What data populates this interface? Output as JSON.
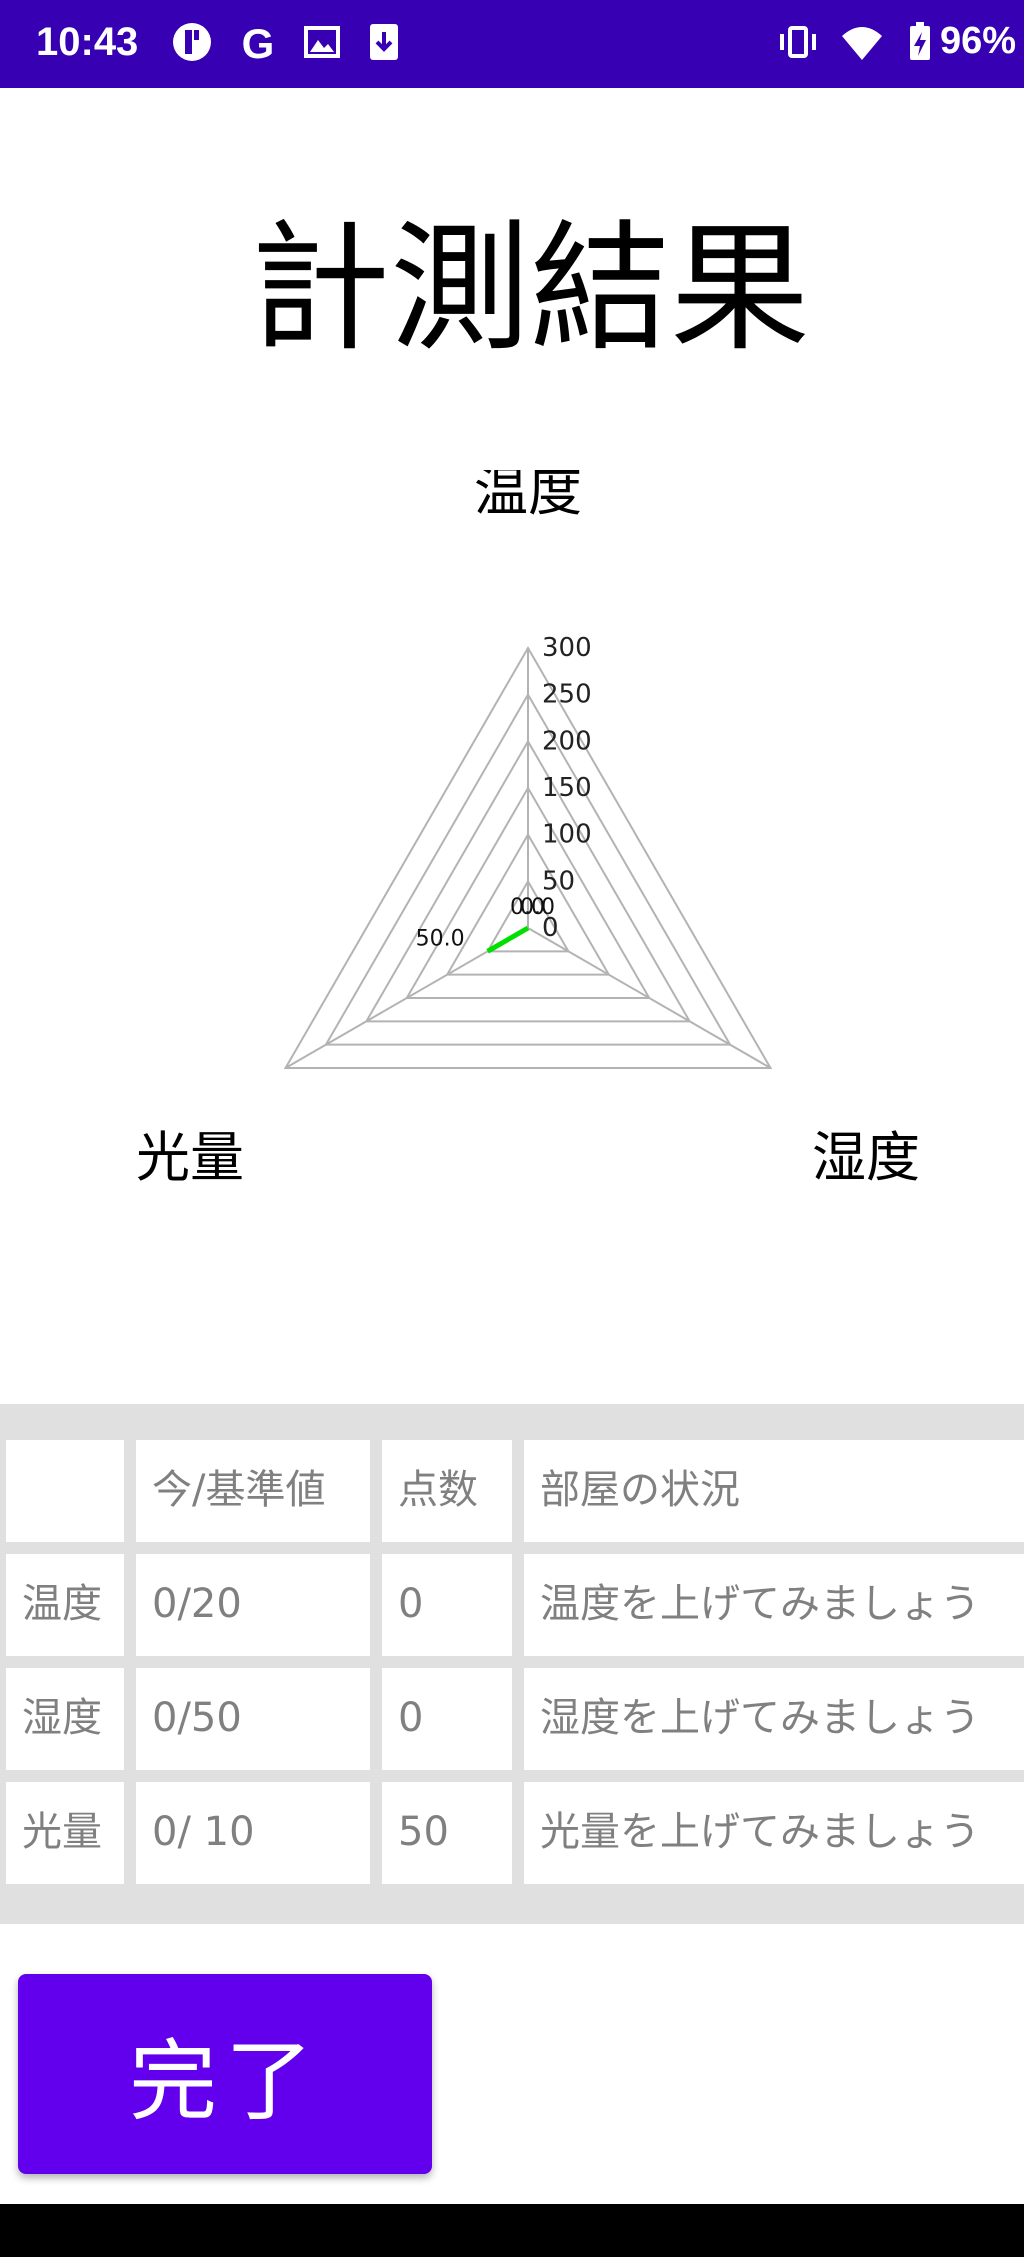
{
  "status_bar": {
    "time": "10:43",
    "battery_percent": "96%",
    "left_icons": [
      "app-icon",
      "google-icon",
      "image-icon",
      "download-icon"
    ],
    "right_icons": [
      "vibrate-icon",
      "wifi-icon",
      "battery-charging-icon"
    ]
  },
  "title": "計測結果",
  "chart_data": {
    "type": "radar",
    "axes": [
      "温度",
      "湿度",
      "光量"
    ],
    "rlim": [
      0,
      300
    ],
    "ticks": [
      "0",
      "50",
      "100",
      "150",
      "200",
      "250",
      "300"
    ],
    "series": [
      {
        "values": [
          0,
          0,
          50
        ],
        "point_labels": [
          "0.0",
          "0.0",
          "50.0"
        ],
        "color": "#00e000"
      }
    ],
    "grid_color": "#b3b3b3",
    "legend": "none"
  },
  "table": {
    "headers": [
      "",
      "今/基準値",
      "点数",
      "部屋の状況"
    ],
    "rows": [
      [
        "温度",
        "0/20",
        "0",
        "温度を上げてみましょう"
      ],
      [
        "湿度",
        "0/50",
        "0",
        "湿度を上げてみましょう"
      ],
      [
        "光量",
        "0/ 10",
        "50",
        "光量を上げてみましょう"
      ]
    ]
  },
  "done_button": {
    "label": "完了"
  },
  "colors": {
    "status_bar": "#3700b3",
    "primary": "#6200ee",
    "table_bg": "#e0e0e0"
  }
}
